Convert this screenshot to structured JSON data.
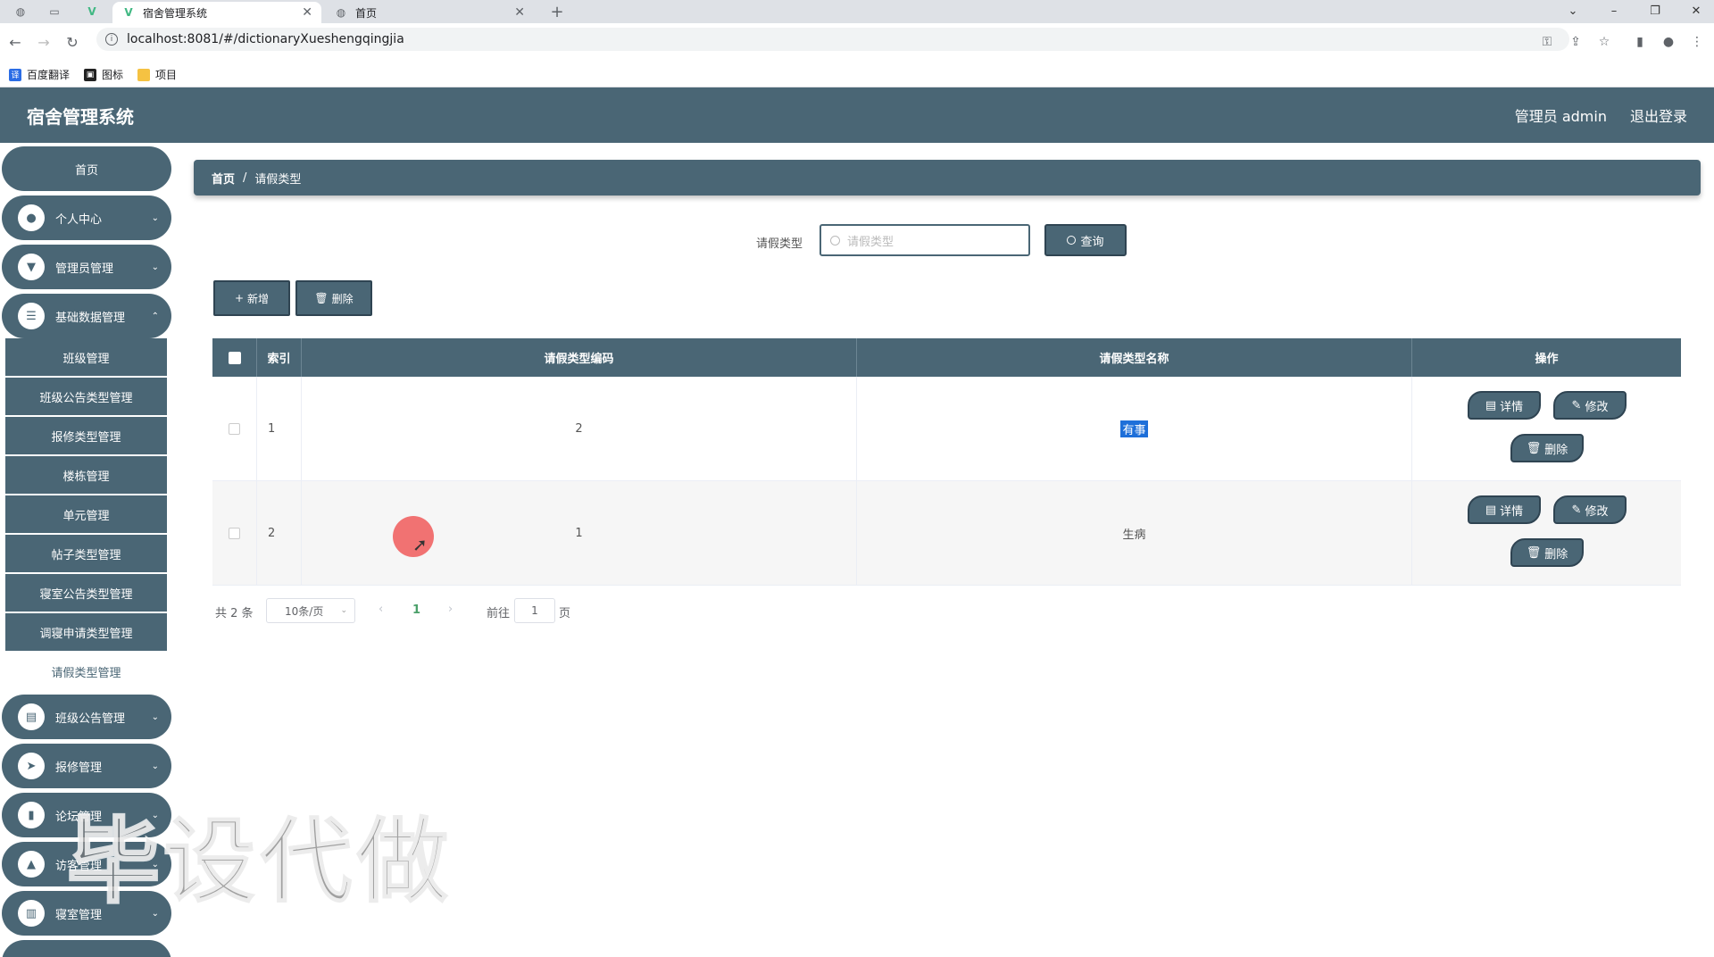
{
  "browser": {
    "tabs": [
      {
        "label": "宿舍管理系统",
        "icon": "vue-logo-icon",
        "active": true
      },
      {
        "label": "首页",
        "icon": "globe-icon",
        "active": false
      }
    ],
    "url": "localhost:8081/#/dictionaryXueshengqingjia",
    "bookmarks": [
      {
        "label": "百度翻译",
        "color": "#2b6de5"
      },
      {
        "label": "图标",
        "color": "#222222"
      },
      {
        "label": "项目",
        "color": "#f5c242"
      }
    ]
  },
  "header": {
    "title": "宿舍管理系统",
    "user": "管理员 admin",
    "logout": "退出登录"
  },
  "sidebar": {
    "home": "首页",
    "menus": [
      {
        "label": "个人中心",
        "icon": "user-icon"
      },
      {
        "label": "管理员管理",
        "icon": "admin-icon"
      },
      {
        "label": "基础数据管理",
        "icon": "list-icon"
      }
    ],
    "submenus": [
      {
        "label": "班级管理"
      },
      {
        "label": "班级公告类型管理"
      },
      {
        "label": "报修类型管理"
      },
      {
        "label": "楼栋管理"
      },
      {
        "label": "单元管理"
      },
      {
        "label": "帖子类型管理"
      },
      {
        "label": "寝室公告类型管理"
      },
      {
        "label": "调寝申请类型管理"
      },
      {
        "label": "请假类型管理",
        "active": true
      }
    ],
    "menus_bottom": [
      {
        "label": "班级公告管理",
        "icon": "notice-icon"
      },
      {
        "label": "报修管理",
        "icon": "send-icon"
      },
      {
        "label": "论坛管理",
        "icon": "forum-icon"
      },
      {
        "label": "访客管理",
        "icon": "visitor-icon"
      },
      {
        "label": "寝室管理",
        "icon": "room-icon"
      }
    ]
  },
  "breadcrumb": {
    "home": "首页",
    "separator": "/",
    "current": "请假类型"
  },
  "search": {
    "label": "请假类型",
    "placeholder": "请假类型",
    "button": "查询"
  },
  "actions": {
    "add": "新增",
    "delete": "删除"
  },
  "table": {
    "columns": [
      "索引",
      "请假类型编码",
      "请假类型名称",
      "操作"
    ],
    "rows": [
      {
        "index": "1",
        "code": "2",
        "name": "有事"
      },
      {
        "index": "2",
        "code": "1",
        "name": "生病"
      }
    ],
    "row_actions": {
      "detail": "详情",
      "edit": "修改",
      "delete": "删除"
    }
  },
  "pagination": {
    "total": "共 2 条",
    "page_size": "10条/页",
    "current": "1",
    "goto_label": "前往",
    "goto_value": "1",
    "page_suffix": "页"
  },
  "watermark": "毕设代做",
  "colors": {
    "primary": "#4a6675",
    "border_dark": "#2f4452",
    "page_active": "#4ba06a",
    "selection": "#1e6fd9"
  }
}
